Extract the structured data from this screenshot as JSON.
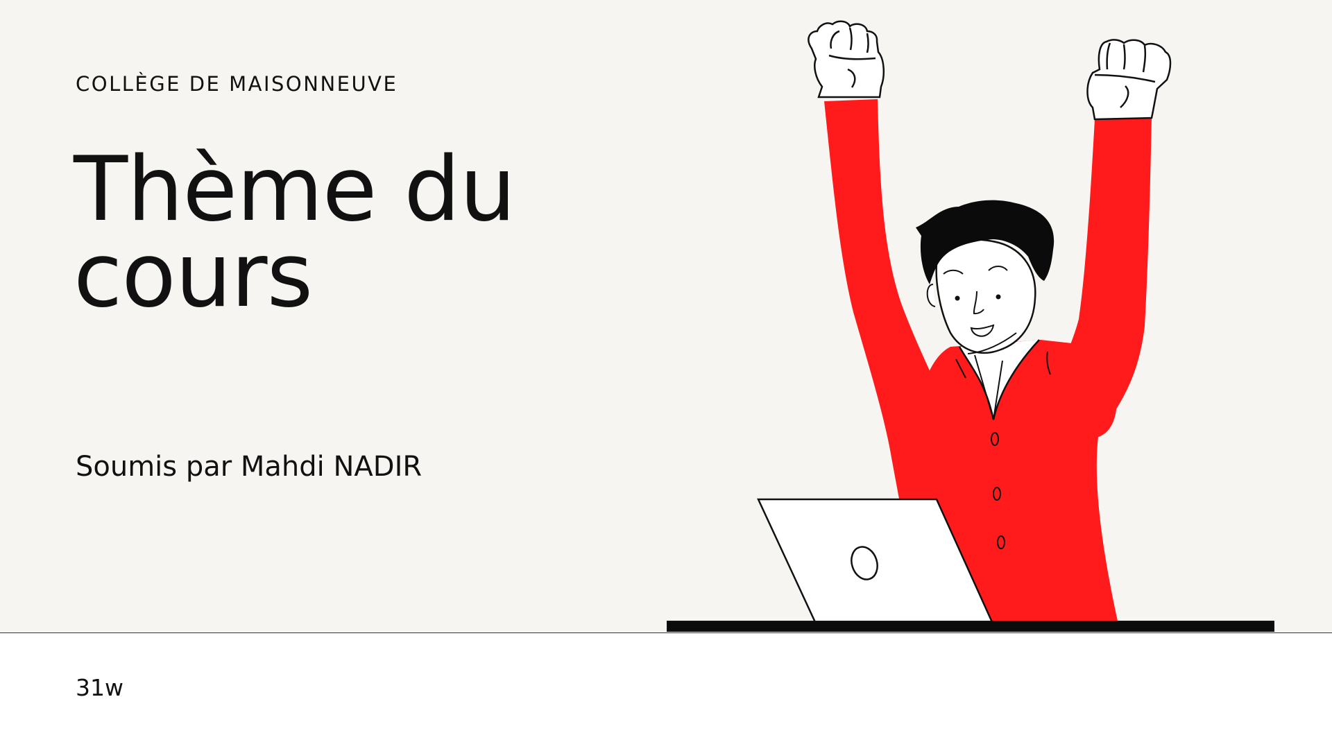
{
  "slide": {
    "institution": "COLLÈGE DE MAISONNEUVE",
    "title": "Thème du cours",
    "author": "Soumis par Mahdi NADIR",
    "course_code": "31w"
  },
  "illustration": {
    "subject": "man-celebrating-at-laptop",
    "accent_color": "#ff1b1b"
  },
  "colors": {
    "background_top": "#f6f5f1",
    "background_bottom": "#ffffff",
    "text": "#111111"
  }
}
